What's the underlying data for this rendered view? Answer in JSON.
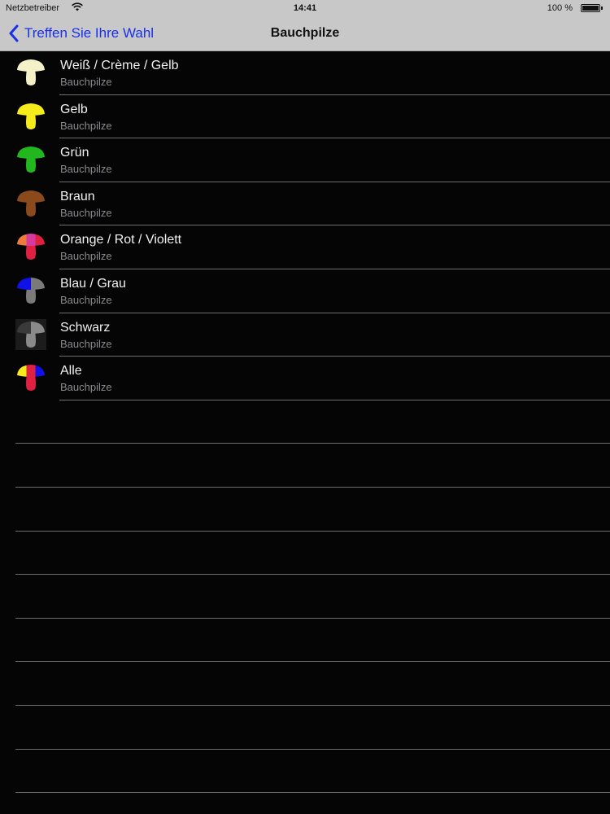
{
  "status_bar": {
    "carrier": "Netzbetreiber",
    "time": "14:41",
    "battery": "100 %"
  },
  "nav": {
    "back_label": "Treffen Sie Ihre Wahl",
    "title": "Bauchpilze",
    "accent_color": "#1930e6"
  },
  "items": [
    {
      "title": "Weiß / Crème / Gelb",
      "subtitle": "Bauchpilze",
      "icon": "mushroom-white-cream-yellow-icon",
      "colors": [
        "#f4f0c8",
        "#f4f0c8"
      ]
    },
    {
      "title": "Gelb",
      "subtitle": "Bauchpilze",
      "icon": "mushroom-yellow-icon",
      "colors": [
        "#f5ea1a",
        "#f5ea1a"
      ]
    },
    {
      "title": "Grün",
      "subtitle": "Bauchpilze",
      "icon": "mushroom-green-icon",
      "colors": [
        "#22b61f",
        "#22b61f"
      ]
    },
    {
      "title": "Braun",
      "subtitle": "Bauchpilze",
      "icon": "mushroom-brown-icon",
      "colors": [
        "#8a4a1c",
        "#8a4a1c"
      ]
    },
    {
      "title": "Orange / Rot / Violett",
      "subtitle": "Bauchpilze",
      "icon": "mushroom-orange-red-violet-icon",
      "colors": [
        "#f07a3a",
        "#d63aa0",
        "#e02040"
      ]
    },
    {
      "title": "Blau / Grau",
      "subtitle": "Bauchpilze",
      "icon": "mushroom-blue-grey-icon",
      "colors": [
        "#1010e8",
        "#7a7a7a"
      ]
    },
    {
      "title": "Schwarz",
      "subtitle": "Bauchpilze",
      "icon": "mushroom-black-icon",
      "colors": [
        "#3a3a3a",
        "#8a8a8a"
      ]
    },
    {
      "title": "Alle",
      "subtitle": "Bauchpilze",
      "icon": "mushroom-all-colors-icon",
      "colors": [
        "#f5ea1a",
        "#e02040",
        "#1010e8"
      ]
    }
  ]
}
